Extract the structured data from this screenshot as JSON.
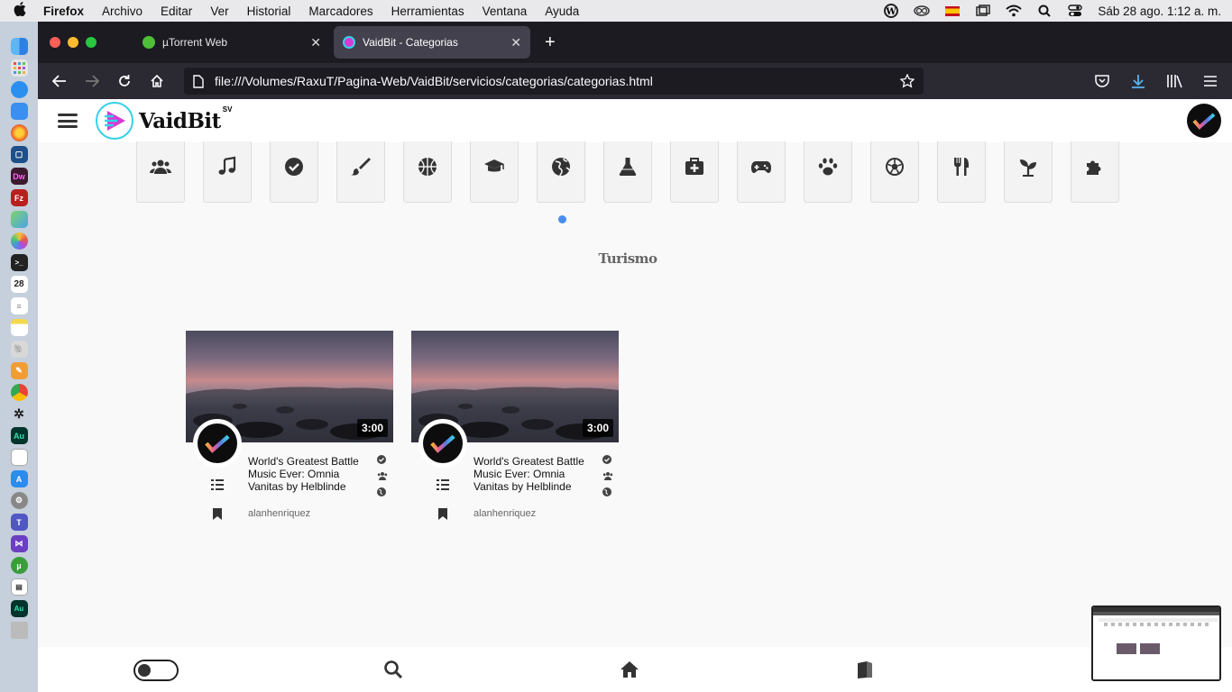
{
  "menubar": {
    "app": "Firefox",
    "items": [
      "Archivo",
      "Editar",
      "Ver",
      "Historial",
      "Marcadores",
      "Herramientas",
      "Ventana",
      "Ayuda"
    ],
    "clock": "Sáb 28 ago.  1:12 a. m."
  },
  "browser": {
    "tabs": [
      {
        "label": "µTorrent Web"
      },
      {
        "label": "VaidBit - Categorias"
      }
    ],
    "url": "file:///Volumes/RaxuT/Pagina-Web/VaidBit/servicios/categorias/categorias.html"
  },
  "site": {
    "logo_text": "VaidBit",
    "logo_sup": "SV",
    "categories": [
      {
        "icon": "users-icon"
      },
      {
        "icon": "music-icon"
      },
      {
        "icon": "check-circle-icon"
      },
      {
        "icon": "paint-brush-icon"
      },
      {
        "icon": "basketball-icon"
      },
      {
        "icon": "graduation-cap-icon"
      },
      {
        "icon": "globe-icon"
      },
      {
        "icon": "flask-icon"
      },
      {
        "icon": "medkit-icon"
      },
      {
        "icon": "gamepad-icon"
      },
      {
        "icon": "paw-icon"
      },
      {
        "icon": "soccer-ball-icon"
      },
      {
        "icon": "utensils-icon"
      },
      {
        "icon": "seedling-icon"
      },
      {
        "icon": "puzzle-icon"
      }
    ],
    "section_title": "Turismo",
    "videos": [
      {
        "title": "World's Greatest Battle Music Ever: Omnia Vanitas by Helblinde",
        "duration": "3:00",
        "author": "alanhenriquez"
      },
      {
        "title": "World's Greatest Battle Music Ever: Omnia Vanitas by Helblinde",
        "duration": "3:00",
        "author": "alanhenriquez"
      }
    ]
  },
  "colors": {
    "accent_blue": "#4a8ef0",
    "logo_cyan": "#36d1e8",
    "logo_magenta": "#d63bd3"
  }
}
